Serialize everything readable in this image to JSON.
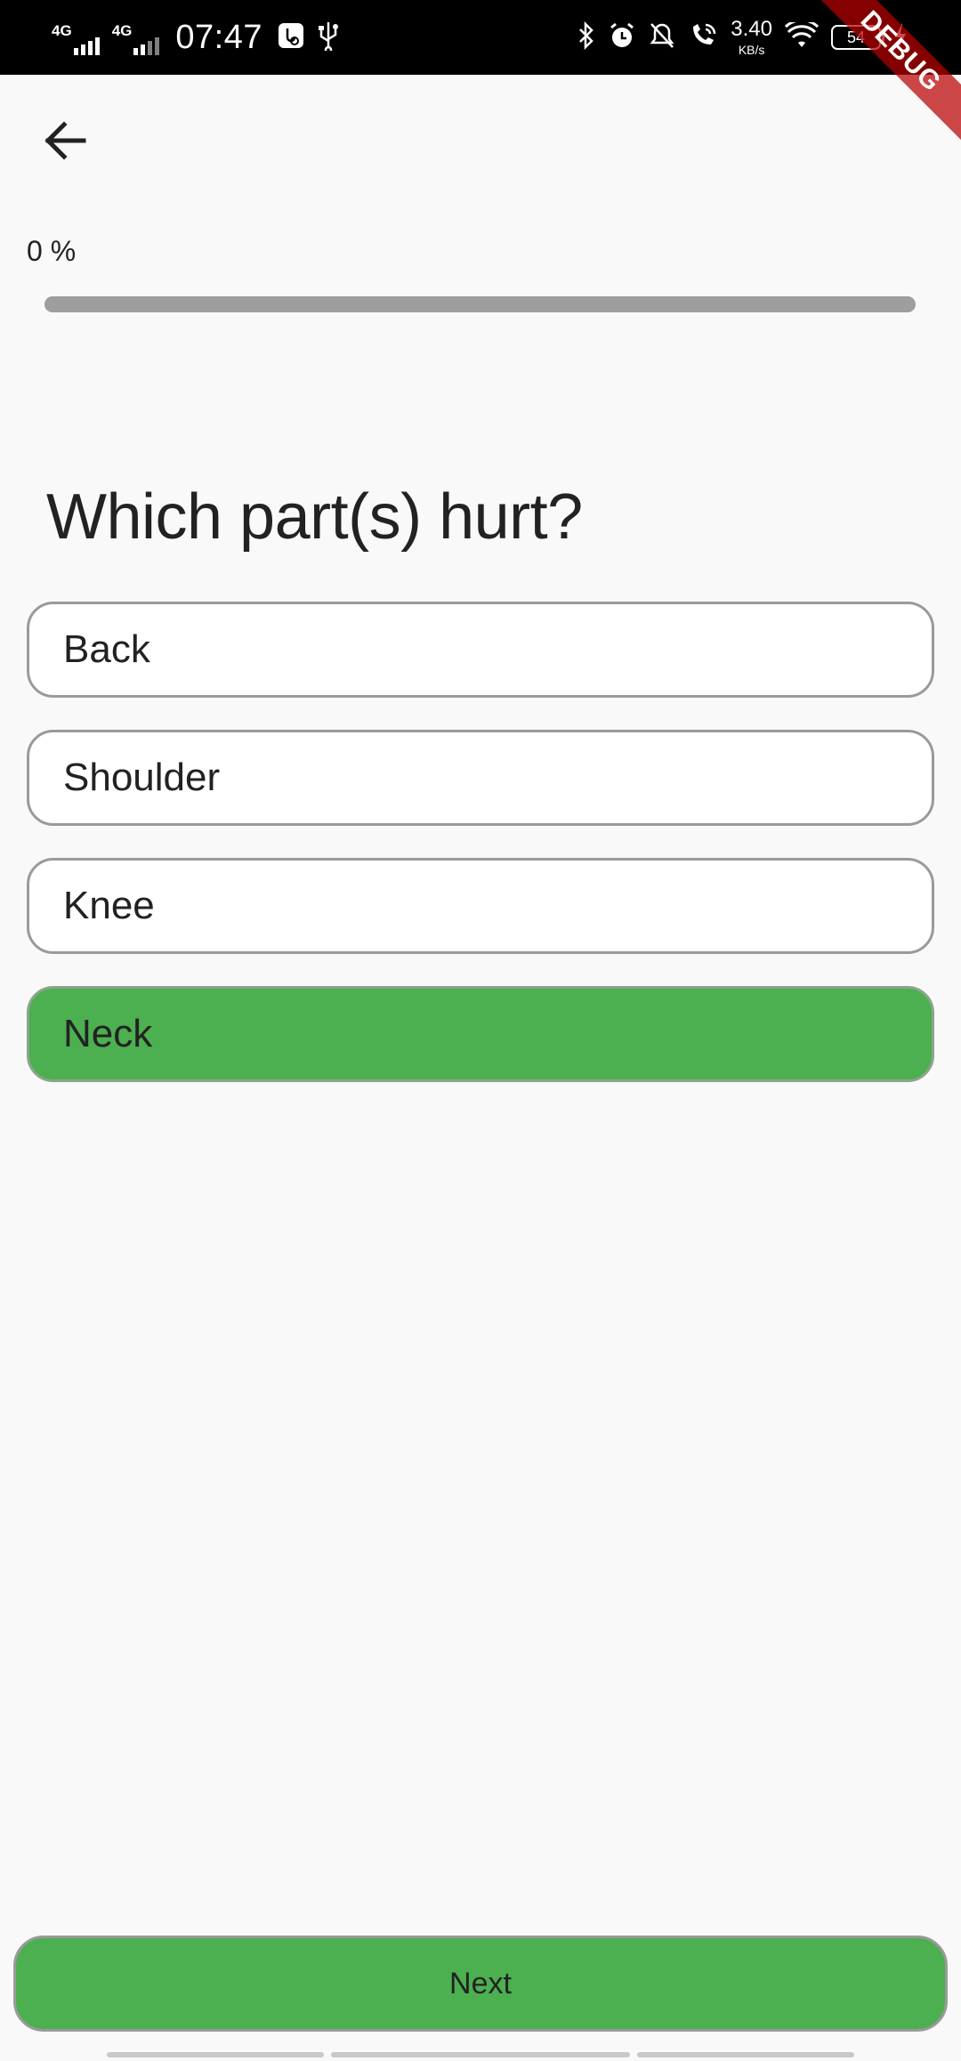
{
  "status_bar": {
    "network_1": "4G",
    "network_2": "4G",
    "time": "07:47",
    "speed_value": "3.40",
    "speed_unit": "KB/s",
    "battery_level": "54"
  },
  "debug_banner": "DEBUG",
  "header": {
    "back_icon": "arrow-left-icon"
  },
  "progress": {
    "label": "0 %",
    "value": 0
  },
  "question": {
    "title": "Which part(s) hurt?",
    "options": [
      {
        "label": "Back",
        "selected": false
      },
      {
        "label": "Shoulder",
        "selected": false
      },
      {
        "label": "Knee",
        "selected": false
      },
      {
        "label": "Neck",
        "selected": true
      }
    ]
  },
  "footer": {
    "next_label": "Next"
  },
  "colors": {
    "accent": "#4caf50",
    "progress_track": "#9e9e9e",
    "background": "#f9f9f9"
  }
}
